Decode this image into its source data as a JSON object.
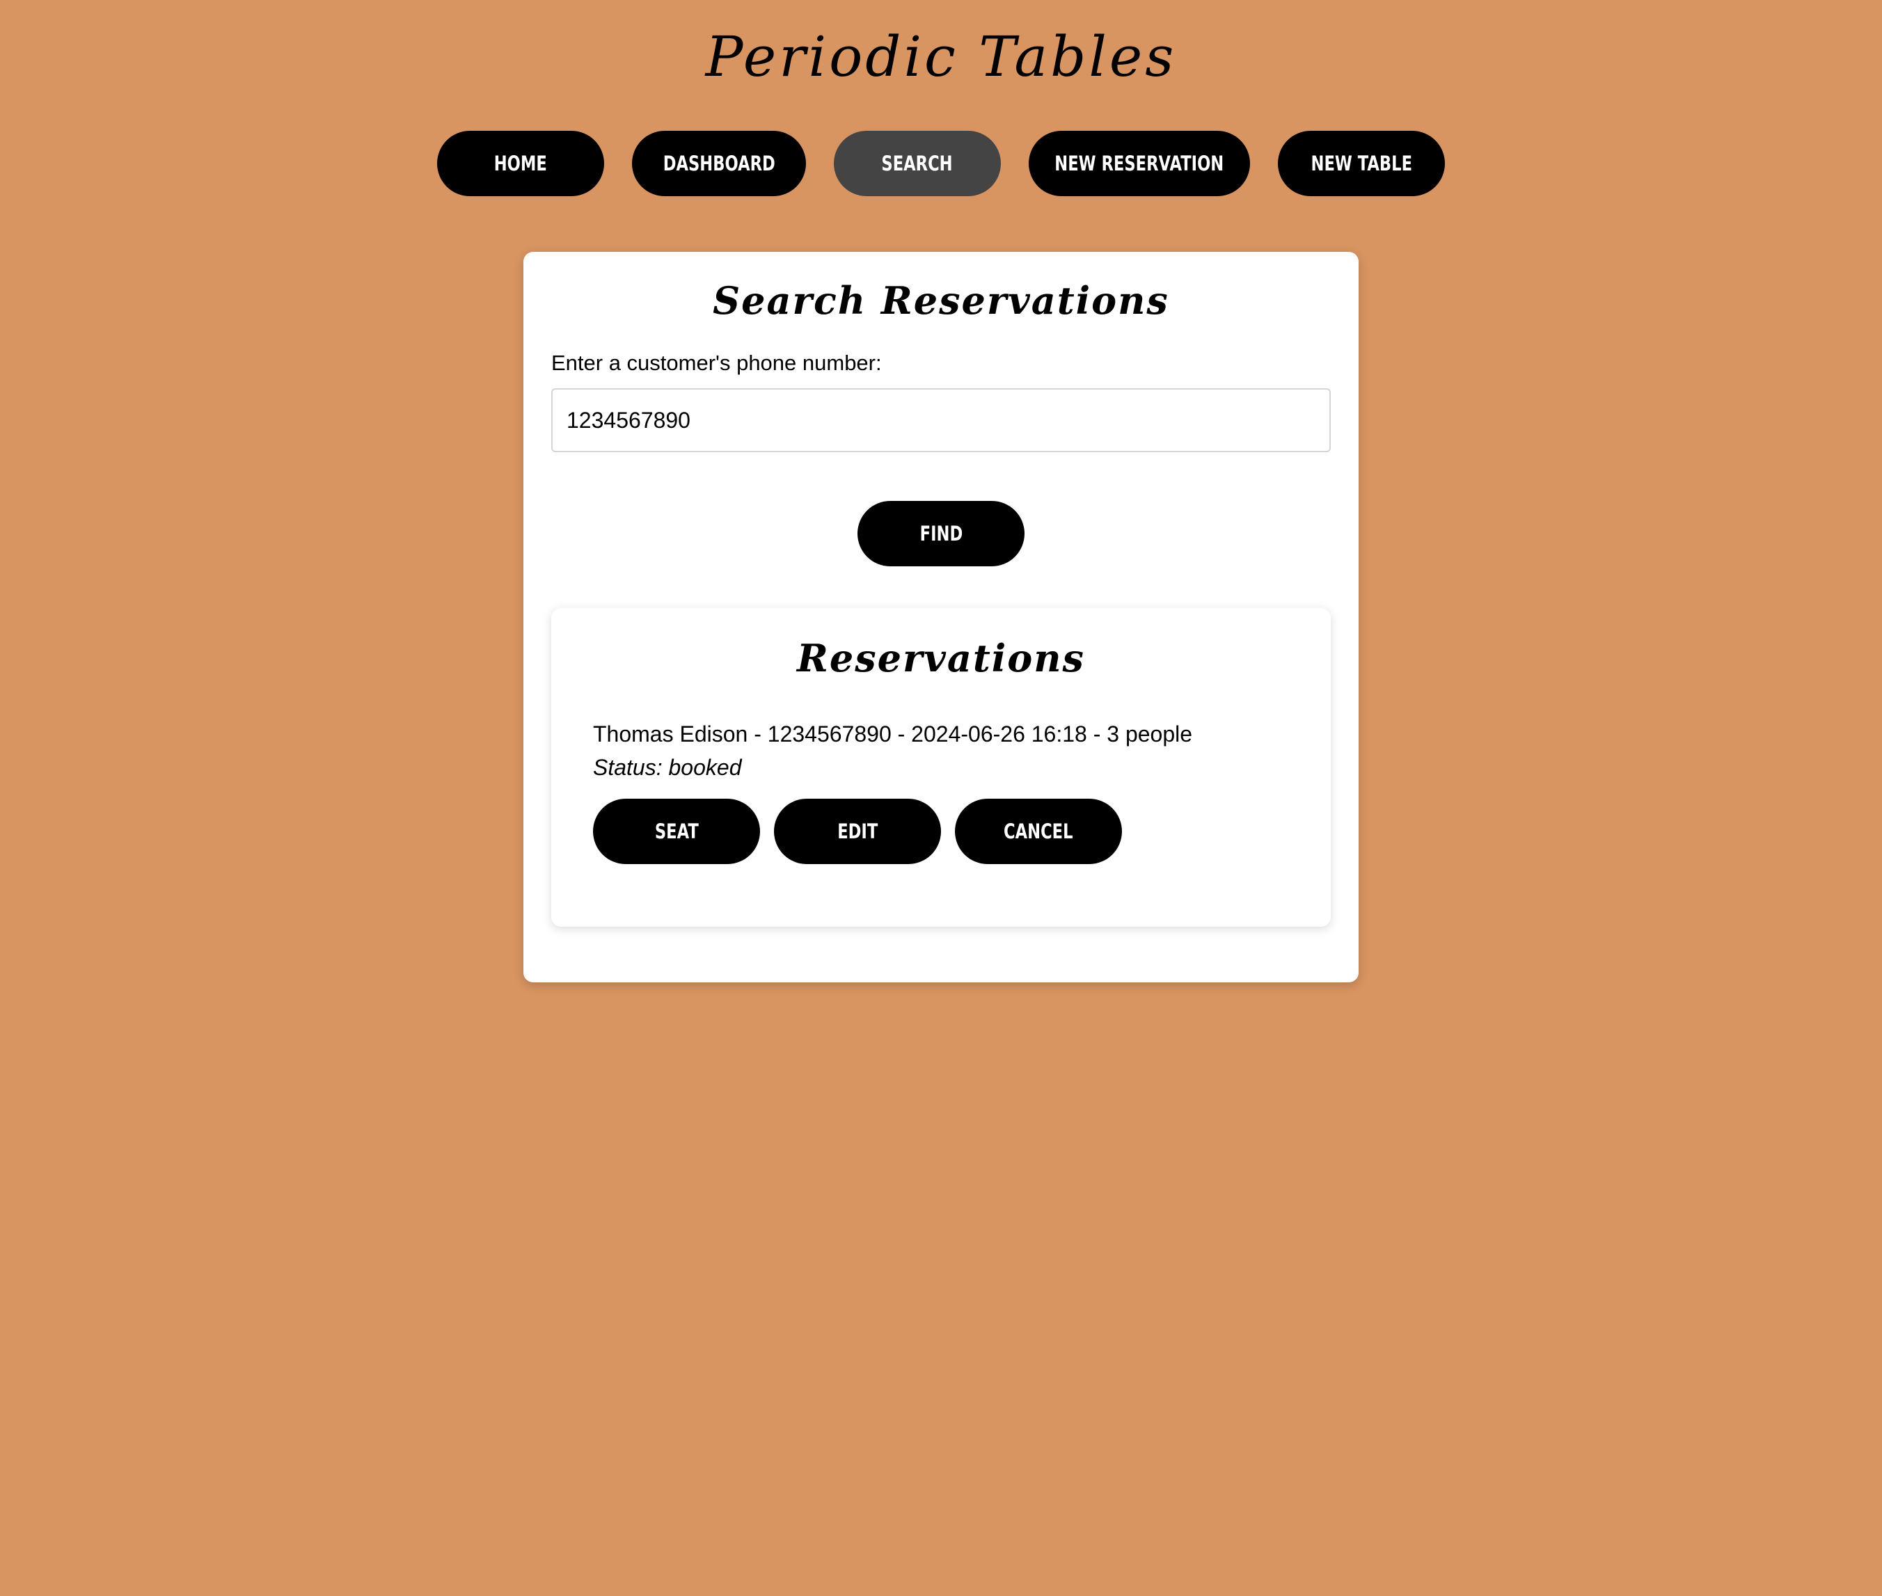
{
  "app": {
    "title": "Periodic Tables"
  },
  "nav": {
    "items": [
      {
        "label": "Home",
        "active": false
      },
      {
        "label": "Dashboard",
        "active": false
      },
      {
        "label": "Search",
        "active": true
      },
      {
        "label": "New Reservation",
        "active": false
      },
      {
        "label": "New Table",
        "active": false
      }
    ]
  },
  "search": {
    "title": "Search Reservations",
    "label": "Enter a customer's phone number:",
    "value": "1234567890",
    "find_label": "Find"
  },
  "reservations": {
    "title": "Reservations",
    "items": [
      {
        "summary": "Thomas Edison - 1234567890 - 2024-06-26 16:18 - 3 people",
        "status": "Status: booked",
        "seat_label": "Seat",
        "edit_label": "Edit",
        "cancel_label": "Cancel"
      }
    ]
  },
  "colors": {
    "background": "#d89461",
    "button": "#000000",
    "button_active": "#444444",
    "card": "#ffffff"
  }
}
